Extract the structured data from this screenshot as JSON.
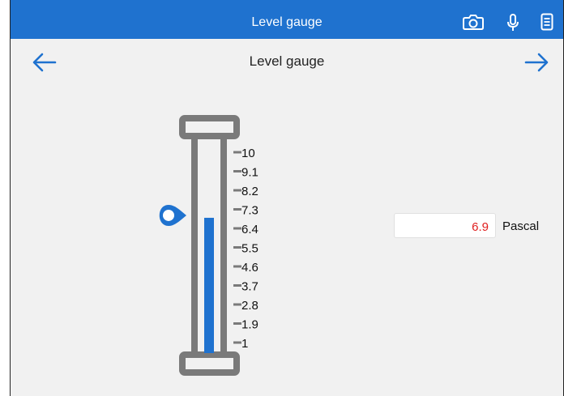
{
  "window": {
    "title": "Level gauge"
  },
  "toolbar": {
    "icons": [
      "camera-icon",
      "microphone-icon",
      "notes-icon"
    ]
  },
  "navbar": {
    "title": "Level gauge",
    "back_icon": "arrow-left-icon",
    "forward_icon": "arrow-right-icon"
  },
  "gauge": {
    "scale": [
      "10",
      "9.1",
      "8.2",
      "7.3",
      "6.4",
      "5.5",
      "4.6",
      "3.7",
      "2.8",
      "1.9",
      "1"
    ],
    "min": 1,
    "max": 10,
    "value": 6.9,
    "fill_color": "#1f72cf",
    "frame_color": "#7a7a7a",
    "pointer_icon": "location-pin-icon"
  },
  "reading": {
    "value": "6.9",
    "unit": "Pascal",
    "value_color": "#e02020"
  },
  "colors": {
    "accent": "#1f72cf",
    "background": "#f1f1f1"
  }
}
